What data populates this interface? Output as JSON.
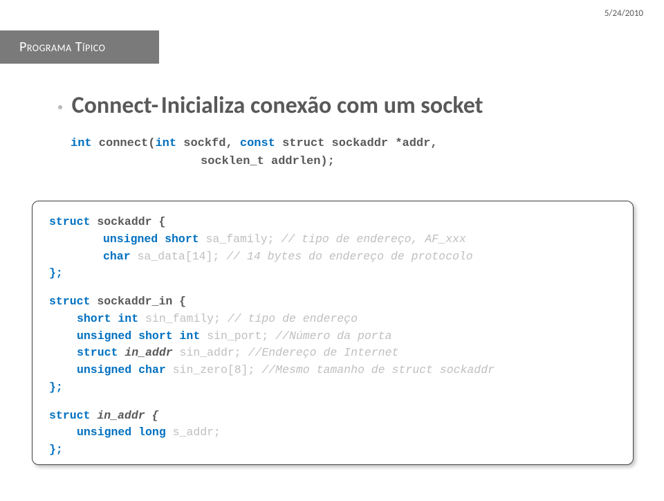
{
  "date": "5/24/2010",
  "header": "Programa Típico",
  "title": {
    "main": "Connect-",
    "sub": "Inicializa conexão com um socket"
  },
  "sig": {
    "kw_int": "int",
    "fn": " connect(",
    "kw_int2": "int",
    "p1": " sockfd, ",
    "kw_const": "const",
    "p2": " struct sockaddr *addr,",
    "p3": "socklen_t addrlen);"
  },
  "code": {
    "l1_kw": "struct",
    "l1_name": " sockaddr {",
    "l2_kw": "unsigned short",
    "l2_rest": "  sa_family; ",
    "l2_cmt": "// tipo de endereço, AF_xxx",
    "l3_kw": "char",
    "l3_rest": " sa_data[14]; ",
    "l3_cmt": "// 14 bytes do endereço de protocolo",
    "l4": "};",
    "l5_kw": "struct",
    "l5_name": " sockaddr_in {",
    "l6_kw": "short int",
    "l6_rest": " sin_family; ",
    "l6_cmt": "// tipo de endereço",
    "l7_kw": "unsigned short int",
    "l7_rest": " sin_port; ",
    "l7_cmt": "//Número da porta",
    "l8_kw": "struct",
    "l8_name": " in_addr",
    "l8_rest": " sin_addr; ",
    "l8_cmt": "//Endereço de Internet",
    "l9_kw": "unsigned char",
    "l9_rest": " sin_zero[8]; ",
    "l9_cmt": "//Mesmo tamanho de struct sockaddr",
    "l10": "};",
    "l11_kw": "struct",
    "l11_name": " in_addr {",
    "l12_kw": "unsigned long",
    "l12_rest": " s_addr;",
    "l13": "};"
  }
}
